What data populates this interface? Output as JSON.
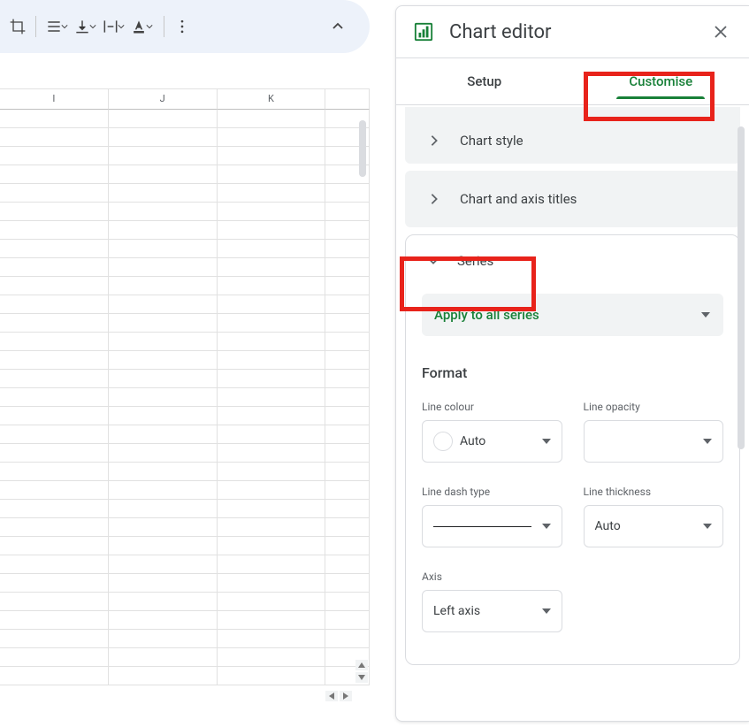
{
  "toolbar": {
    "icons": [
      "crop-icon",
      "horizontal-align-icon",
      "vertical-align-icon",
      "text-wrap-icon",
      "text-color-icon"
    ]
  },
  "sheet": {
    "columns": [
      "I",
      "J",
      "K",
      ""
    ]
  },
  "panel": {
    "title": "Chart editor",
    "tabs": {
      "setup": "Setup",
      "customise": "Customise"
    },
    "sections": {
      "chart_style": "Chart style",
      "chart_axis": "Chart and axis titles",
      "series_label": "Series"
    },
    "series": {
      "apply_label": "Apply to all series",
      "format_label": "Format",
      "line_colour_label": "Line colour",
      "line_colour_value": "Auto",
      "line_opacity_label": "Line opacity",
      "line_opacity_value": "",
      "line_dash_label": "Line dash type",
      "line_thickness_label": "Line thickness",
      "line_thickness_value": "Auto",
      "axis_label": "Axis",
      "axis_value": "Left axis"
    }
  }
}
